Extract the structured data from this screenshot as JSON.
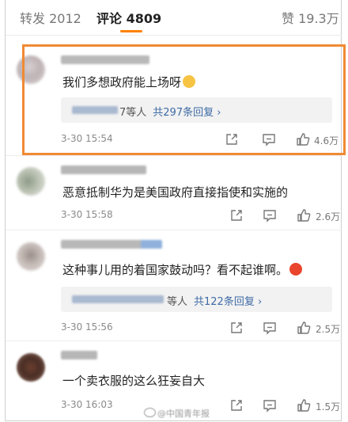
{
  "tabs": {
    "repost_label": "转发",
    "repost_count": "2012",
    "comment_label": "评论",
    "comment_count": "4809",
    "like_label": "赞",
    "like_count": "19.3万"
  },
  "accent_color": "#ff8200",
  "highlight_color": "#f08a33",
  "link_color": "#3e6ba5",
  "comments": [
    {
      "text": "我们多想政府能上场呀",
      "emoji": "laughing-emoji",
      "replies": {
        "who_suffix": "7等人",
        "count": "共297条回复 ›"
      },
      "time": "3-30 15:54",
      "likes": "4.6万"
    },
    {
      "text": "恶意抵制华为是美国政府直接指使和实施的",
      "time": "3-30 15:58",
      "likes": "2.6万"
    },
    {
      "text": "这种事儿用的着国家鼓动吗？看不起谁啊。",
      "emoji": "angry-emoji",
      "replies": {
        "who_suffix": "等人",
        "count": "共122条回复 ›"
      },
      "time": "3-30 15:56",
      "likes": "2.5万"
    },
    {
      "text": "一个卖衣服的这么狂妄自大",
      "time": "3-30 16:03",
      "likes": "1.5万"
    }
  ],
  "watermark": "@中国青年报",
  "icons": [
    "share-icon",
    "comment-icon",
    "like-icon"
  ]
}
